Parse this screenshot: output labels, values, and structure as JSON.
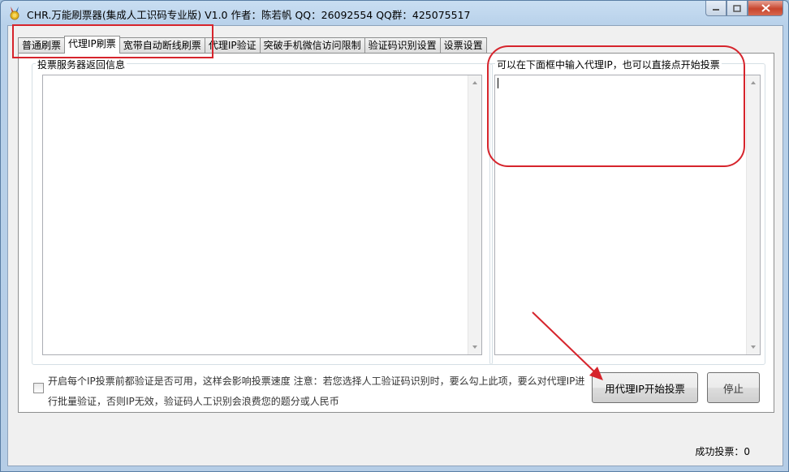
{
  "window": {
    "title": "CHR.万能刷票器(集成人工识码专业版) V1.0 作者：陈若帆 QQ：26092554 QQ群：425075517",
    "app_icon": "medal-icon",
    "controls": {
      "minimize": "minimize-icon",
      "maximize": "maximize-icon",
      "close": "close-icon"
    }
  },
  "tabs": [
    {
      "label": "普通刷票",
      "active": false
    },
    {
      "label": "代理IP刷票",
      "active": true
    },
    {
      "label": "宽带自动断线刷票",
      "active": false
    },
    {
      "label": "代理IP验证",
      "active": false
    },
    {
      "label": "突破手机微信访问限制",
      "active": false
    },
    {
      "label": "验证码识别设置",
      "active": false
    },
    {
      "label": "设票设置",
      "active": false
    }
  ],
  "panel": {
    "server_info_label": "投票服务器返回信息",
    "server_info_value": "",
    "proxy_input_label": "可以在下面框中输入代理IP，也可以直接点开始投票",
    "proxy_input_value": "",
    "verify_checkbox_checked": false,
    "verify_note": "开启每个IP投票前都验证是否可用，这样会影响投票速度 注意：若您选择人工验证码识别时，要么勾上此项，要么对代理IP进行批量验证，否则IP无效，验证码人工识别会浪费您的题分或人民币",
    "start_button": "用代理IP开始投票",
    "stop_button": "停止"
  },
  "status": {
    "success_votes": "成功投票：0"
  },
  "colors": {
    "annotation_red": "#d6242c",
    "title_bar": "#b8d1ea"
  }
}
